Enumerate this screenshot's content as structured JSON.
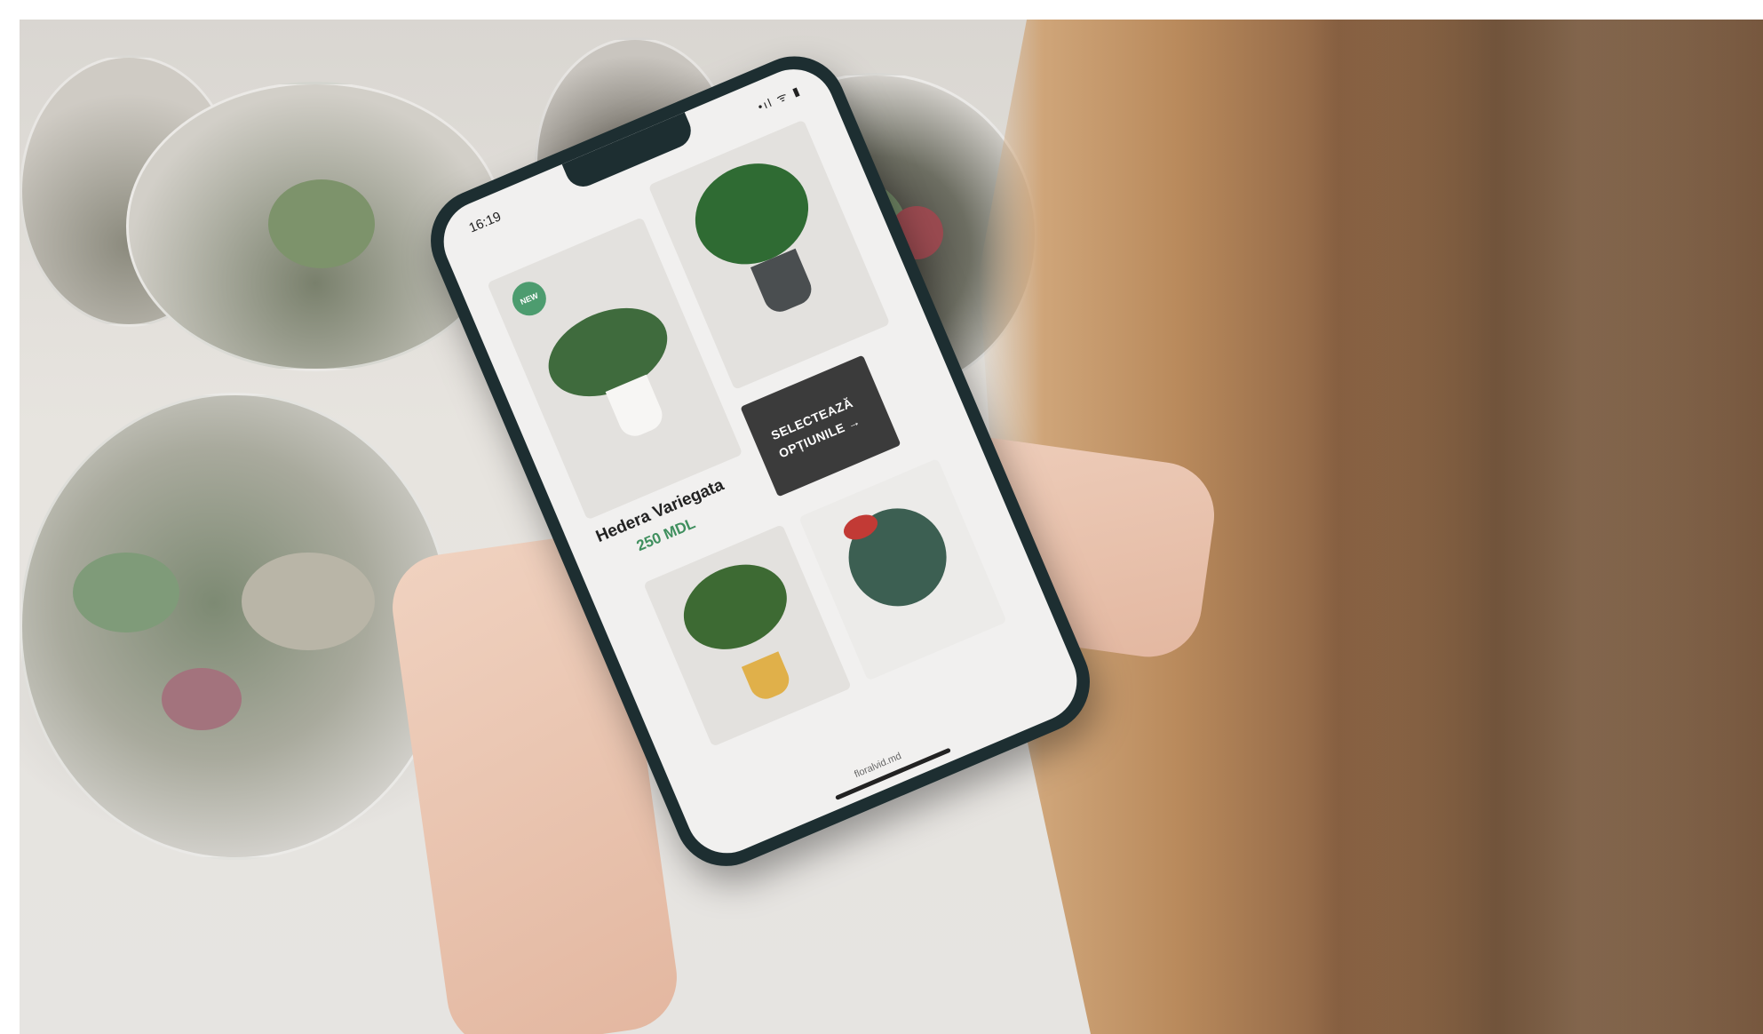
{
  "scene": {
    "description_tags": [
      "photo",
      "smartphone",
      "plant-shop-app",
      "terrariums",
      "hand"
    ]
  },
  "app": {
    "status_time": "16:19",
    "status_icons": "•ıl ᯤ ▮",
    "product": {
      "name": "Hedera Variegata",
      "price": "250 MDL",
      "badge": "NEW"
    },
    "cta": {
      "line1": "SELECTEAZĂ",
      "line2": "OPȚIUNILE",
      "arrow": "→"
    },
    "footer_site": "floralvid.md"
  },
  "colors": {
    "brand_green": "#4d9c6f",
    "price_green": "#3f8f5e",
    "cta_bg": "#3b3b3b",
    "sweater_blue": "#1c5a92"
  }
}
